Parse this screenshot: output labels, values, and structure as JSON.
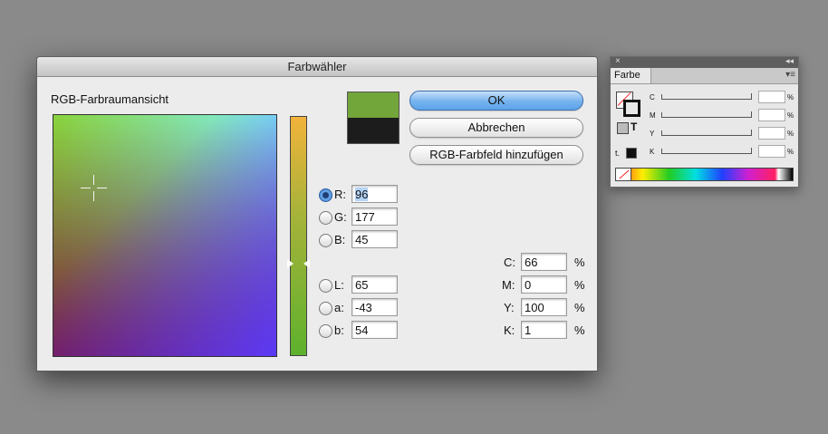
{
  "dialog": {
    "title": "Farbwähler",
    "view_label": "RGB-Farbraumansicht",
    "buttons": {
      "ok": "OK",
      "cancel": "Abbrechen",
      "add_swatch": "RGB-Farbfeld hinzufügen"
    },
    "swatch_new_color": "#72a53a",
    "swatch_old_color": "#1c1c1c",
    "rgb": [
      {
        "label": "R:",
        "value": "96",
        "checked": true
      },
      {
        "label": "G:",
        "value": "177",
        "checked": false
      },
      {
        "label": "B:",
        "value": "45",
        "checked": false
      }
    ],
    "lab": [
      {
        "label": "L:",
        "value": "65"
      },
      {
        "label": "a:",
        "value": "-43"
      },
      {
        "label": "b:",
        "value": "54"
      }
    ],
    "cmyk": [
      {
        "label": "C:",
        "value": "66",
        "unit": "%"
      },
      {
        "label": "M:",
        "value": "0",
        "unit": "%"
      },
      {
        "label": "Y:",
        "value": "100",
        "unit": "%"
      },
      {
        "label": "K:",
        "value": "1",
        "unit": "%"
      }
    ]
  },
  "panel": {
    "tab_label": "Farbe",
    "close_glyph": "×",
    "collapse_glyph": "◂◂",
    "menu_glyph": "▾≡",
    "sliders": [
      {
        "label": "C",
        "unit": "%"
      },
      {
        "label": "M",
        "unit": "%"
      },
      {
        "label": "Y",
        "unit": "%"
      },
      {
        "label": "K",
        "unit": "%"
      }
    ],
    "text_icon": "T"
  }
}
